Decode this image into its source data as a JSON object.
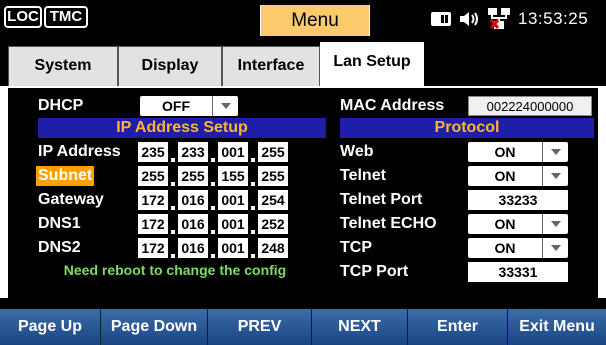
{
  "status": {
    "loc_label": "LOC",
    "tmc_label": "TMC",
    "menu_title": "Menu",
    "clock": "13:53:25"
  },
  "tabs": [
    {
      "label": "System"
    },
    {
      "label": "Display"
    },
    {
      "label": "Interface"
    },
    {
      "label": "Lan Setup"
    }
  ],
  "dhcp": {
    "label": "DHCP",
    "value": "OFF"
  },
  "ip_setup": {
    "title": "IP Address Setup",
    "rows": [
      {
        "label": "IP Address",
        "octets": [
          "235",
          "233",
          "001",
          "255"
        ]
      },
      {
        "label": "Subnet",
        "octets": [
          "255",
          "255",
          "155",
          "255"
        ]
      },
      {
        "label": "Gateway",
        "octets": [
          "172",
          "016",
          "001",
          "254"
        ]
      },
      {
        "label": "DNS1",
        "octets": [
          "172",
          "016",
          "001",
          "252"
        ]
      },
      {
        "label": "DNS2",
        "octets": [
          "172",
          "016",
          "001",
          "248"
        ]
      }
    ],
    "notice": "Need reboot to change the config"
  },
  "mac": {
    "label": "MAC Address",
    "value": "002224000000"
  },
  "protocol": {
    "title": "Protocol",
    "web": {
      "label": "Web",
      "value": "ON"
    },
    "telnet": {
      "label": "Telnet",
      "value": "ON"
    },
    "telnet_port": {
      "label": "Telnet Port",
      "value": "33233"
    },
    "telnet_echo": {
      "label": "Telnet ECHO",
      "value": "ON"
    },
    "tcp": {
      "label": "TCP",
      "value": "ON"
    },
    "tcp_port": {
      "label": "TCP Port",
      "value": "33331"
    }
  },
  "softkeys": [
    {
      "label": "Page Up"
    },
    {
      "label": "Page Down"
    },
    {
      "label": "PREV"
    },
    {
      "label": "NEXT"
    },
    {
      "label": "Enter"
    },
    {
      "label": "Exit Menu"
    }
  ],
  "colors": {
    "menu_title_bg": "#fbca6d",
    "band_bg": "#1e1ea8",
    "band_text": "#ffb52e",
    "highlight": "#ffa000",
    "notice": "#7bdc64",
    "softkey_bg": "#1a4483"
  },
  "icons": [
    "storage-icon",
    "speaker-icon",
    "network-disconnected-icon"
  ]
}
